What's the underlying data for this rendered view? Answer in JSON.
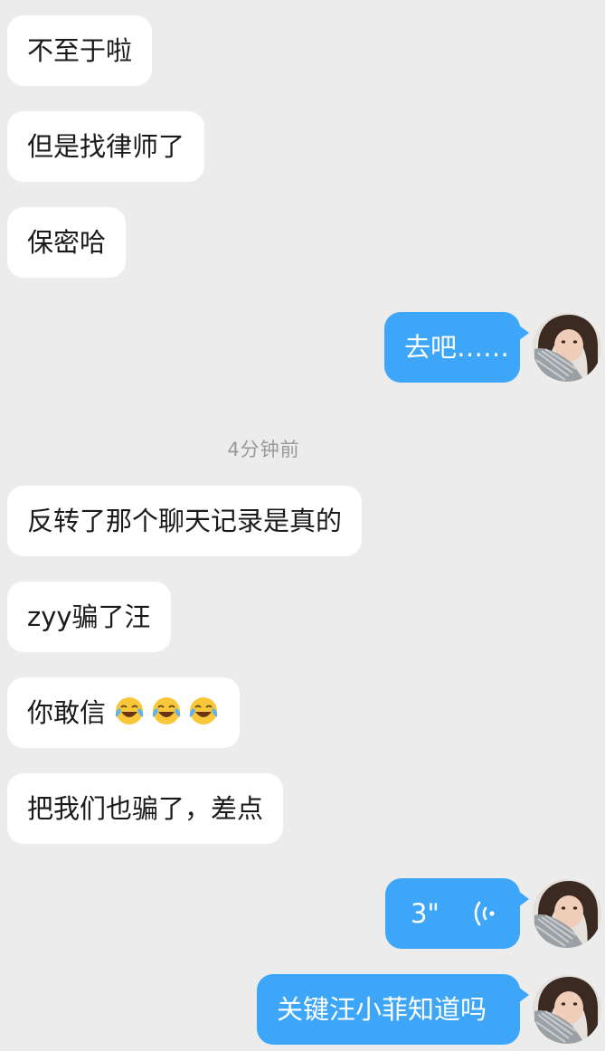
{
  "timestamp": "4分钟前",
  "incoming_group_1": [
    {
      "text": "不至于啦"
    },
    {
      "text": "但是找律师了"
    },
    {
      "text": "保密哈"
    }
  ],
  "outgoing_1": {
    "text": "去吧……"
  },
  "incoming_group_2": [
    {
      "text": "反转了那个聊天记录是真的"
    },
    {
      "text": "zyy骗了汪"
    },
    {
      "text": "你敢信",
      "emoji": [
        "face-with-tears-of-joy-icon",
        "face-with-tears-of-joy-icon",
        "face-with-tears-of-joy-icon"
      ]
    },
    {
      "text": "把我们也骗了，差点"
    }
  ],
  "voice_message": {
    "duration": "3\"",
    "icon": "voice-wave-icon"
  },
  "outgoing_2": {
    "text": "关键汪小菲知道吗"
  },
  "colors": {
    "background": "#ececec",
    "incoming_bubble": "#ffffff",
    "outgoing_bubble": "#3ea6f8",
    "timestamp_text": "#9a9a9a"
  }
}
